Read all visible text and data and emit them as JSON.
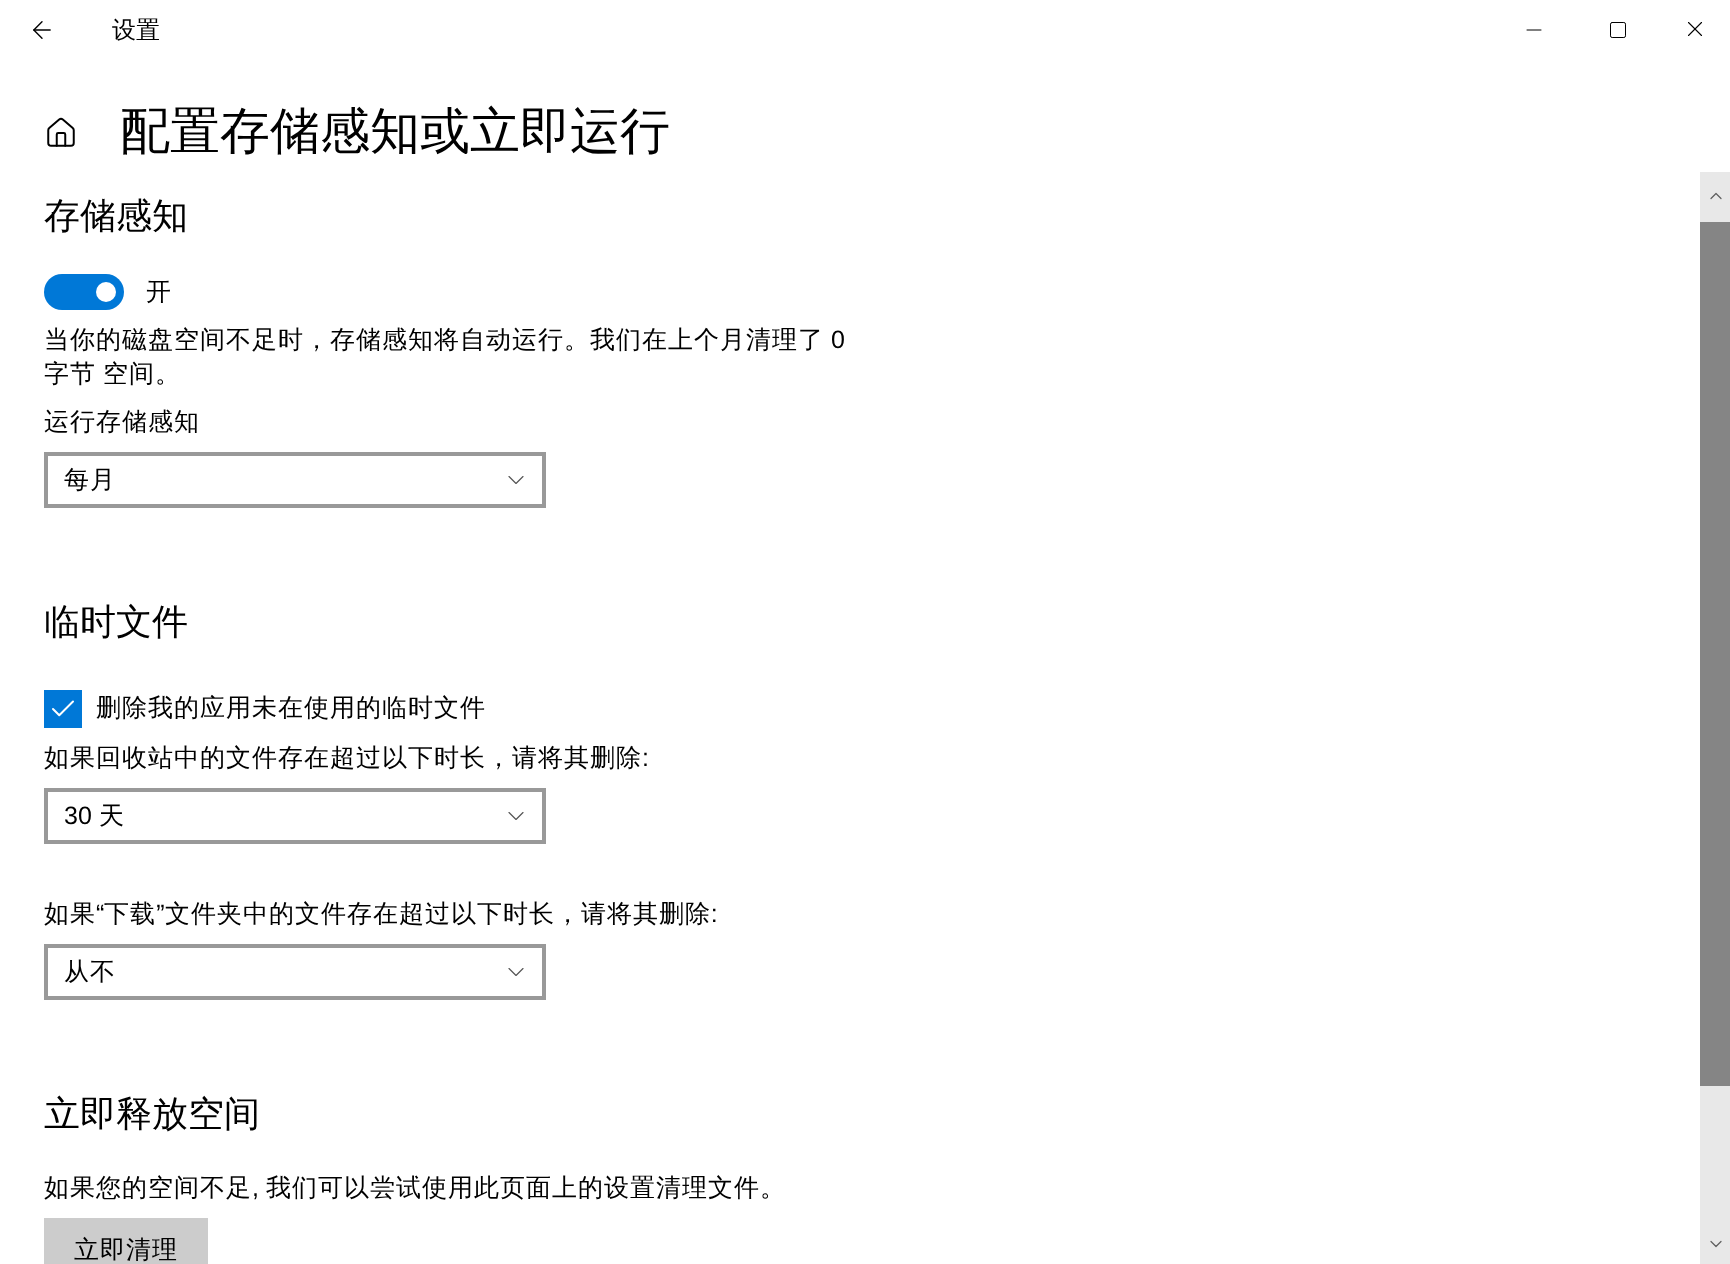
{
  "window": {
    "title": "设置"
  },
  "page": {
    "title": "配置存储感知或立即运行"
  },
  "sections": [
    {
      "heading": "存储感知",
      "items": [
        {
          "kind": "toggle",
          "on": true,
          "label": "开"
        },
        {
          "kind": "text",
          "text": "当你的磁盘空间不足时，存储感知将自动运行。我们在上个月清理了 0 字节 空间。"
        },
        {
          "kind": "dropdown",
          "label": "运行存储感知",
          "value": "每月"
        }
      ]
    },
    {
      "heading": "临时文件",
      "items": [
        {
          "kind": "checkbox",
          "checked": true,
          "label": "删除我的应用未在使用的临时文件"
        },
        {
          "kind": "dropdown",
          "label": "如果回收站中的文件存在超过以下时长，请将其删除:",
          "value": "30 天"
        },
        {
          "kind": "dropdown",
          "label": "如果“下载”文件夹中的文件存在超过以下时长，请将其删除:",
          "value": "从不"
        }
      ]
    },
    {
      "heading": "立即释放空间",
      "items": [
        {
          "kind": "text",
          "text": "如果您的空间不足, 我们可以尝试使用此页面上的设置清理文件。"
        },
        {
          "kind": "button",
          "label": "立即清理"
        }
      ]
    }
  ]
}
